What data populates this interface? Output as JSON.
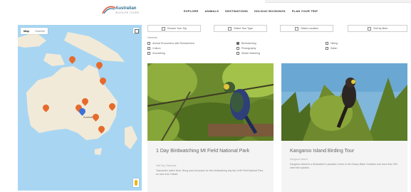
{
  "header": {
    "logo_name": "Australian",
    "logo_sub": "WILDLIFE TOURS",
    "nav": [
      "EXPLORE",
      "ANIMALS",
      "DESTINATIONS",
      "HOLIDAY BOOKINGS",
      "PLAN YOUR TRIP"
    ]
  },
  "map": {
    "toggle": [
      "Map",
      "Satellite"
    ],
    "country_label": "Australia"
  },
  "filters": [
    {
      "label": "Choose Your Trip",
      "icon": "calendar-icon"
    },
    {
      "label": "Select Tour Type",
      "icon": "filter-icon"
    },
    {
      "label": "Select Location",
      "icon": "location-icon"
    },
    {
      "label": "Sort by Best",
      "icon": "sort-icon"
    }
  ],
  "checklist": {
    "title": "Interests",
    "columns": [
      [
        {
          "label": "Animal Encounters with Researchers",
          "checked": false
        },
        {
          "label": "Culture",
          "checked": false
        },
        {
          "label": "Snorkelling",
          "checked": false
        }
      ],
      [
        {
          "label": "Birdwatching",
          "checked": true
        },
        {
          "label": "Photography",
          "checked": false
        },
        {
          "label": "Whale Watching",
          "checked": false
        }
      ],
      [
        {
          "label": "Hiking",
          "checked": false
        },
        {
          "label": "Safari",
          "checked": false
        }
      ]
    ]
  },
  "cards": [
    {
      "title": "1 Day Birdwatching Mt Field National Park",
      "meta": "Half Day   Tasmania",
      "desc": "Tasmania's native birds. Bring your binoculars for this birdwatching day trip in Mt Field National Park, an hour from Hobart."
    },
    {
      "title": "Kangaroo Island Birding Tour",
      "meta": "Kangaroo Island",
      "desc": "Kangaroo Island is a birdwatcher's paradise, home to the Glossy Black Cockatoo and more than 250 other bird species."
    }
  ],
  "colors": {
    "pin": "#e66a2c",
    "pin_selected": "#3b6fd9",
    "ocean": "#a8d6f2",
    "land": "#f2ead8"
  }
}
